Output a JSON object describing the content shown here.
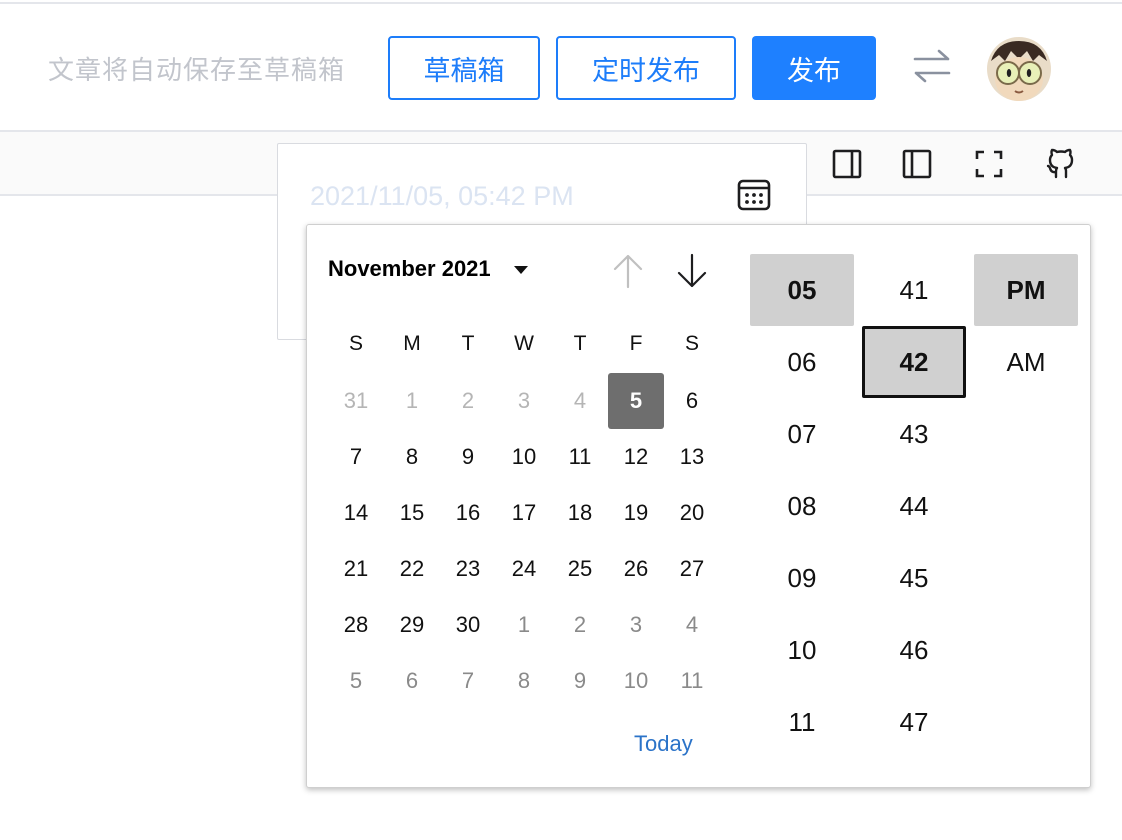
{
  "header": {
    "autosave_text": "文章将自动保存至草稿箱",
    "draft_label": "草稿箱",
    "schedule_label": "定时发布",
    "publish_label": "发布"
  },
  "schedule": {
    "datetime_value": "2021/11/05, 05:42 PM"
  },
  "picker": {
    "month_label": "November 2021",
    "weekdays": [
      "S",
      "M",
      "T",
      "W",
      "T",
      "F",
      "S"
    ],
    "weeks": [
      [
        "31",
        "1",
        "2",
        "3",
        "4",
        "5",
        "6"
      ],
      [
        "7",
        "8",
        "9",
        "10",
        "11",
        "12",
        "13"
      ],
      [
        "14",
        "15",
        "16",
        "17",
        "18",
        "19",
        "20"
      ],
      [
        "21",
        "22",
        "23",
        "24",
        "25",
        "26",
        "27"
      ],
      [
        "28",
        "29",
        "30",
        "1",
        "2",
        "3",
        "4"
      ],
      [
        "5",
        "6",
        "7",
        "8",
        "9",
        "10",
        "11"
      ]
    ],
    "selected_day": "5",
    "today_label": "Today",
    "hours": [
      "05",
      "06",
      "07",
      "08",
      "09",
      "10",
      "11"
    ],
    "minutes": [
      "41",
      "42",
      "43",
      "44",
      "45",
      "46",
      "47"
    ],
    "periods": [
      "PM",
      "AM"
    ],
    "selected_hour": "05",
    "selected_minute": "42",
    "selected_period": "PM"
  },
  "colors": {
    "accent": "#1e80ff",
    "selected_day_bg": "#6e6e6e",
    "selected_time_bg": "#d0d0d0",
    "today_link": "#2b73c8"
  },
  "icons": [
    "swap-arrows-icon",
    "split-right-icon",
    "split-left-icon",
    "fullscreen-icon",
    "github-icon",
    "calendar-icon",
    "arrow-up-icon",
    "arrow-down-icon",
    "caret-down-icon"
  ]
}
